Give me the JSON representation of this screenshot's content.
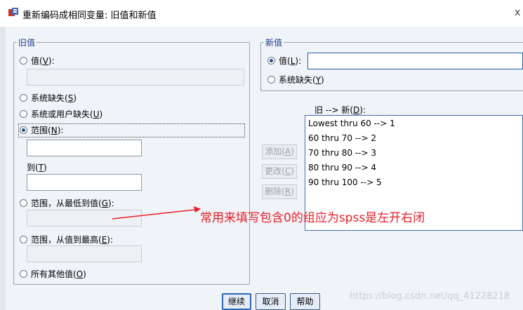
{
  "window": {
    "title": "重新编码成相同变量: 旧值和新值",
    "close": "x"
  },
  "old_value": {
    "legend": "旧值",
    "value_label": "值",
    "value_key": "V",
    "system_missing_label": "系统缺失",
    "system_missing_key": "S",
    "system_or_user_missing_label": "系统或用户缺失",
    "system_or_user_missing_key": "U",
    "range_label": "范围",
    "range_key": "N",
    "to_label": "到",
    "to_key": "T",
    "range_lowest_label": "范围，从最低到值",
    "range_lowest_key": "G",
    "range_highest_label": "范围，从值到最高",
    "range_highest_key": "E",
    "all_other_label": "所有其他值",
    "all_other_key": "O",
    "selected": "range"
  },
  "new_value": {
    "legend": "新值",
    "value_label": "值",
    "value_key": "L",
    "value_input": "",
    "system_missing_label": "系统缺失",
    "system_missing_key": "Y",
    "selected": "value"
  },
  "mapping": {
    "label": "旧 --> 新",
    "label_key": "D",
    "items": [
      "Lowest thru 60 --> 1",
      "60 thru 70 --> 2",
      "70 thru 80 --> 3",
      "80 thru 90 --> 4",
      "90 thru 100 --> 5"
    ]
  },
  "side_buttons": {
    "add": "添加",
    "add_key": "A",
    "change": "更改",
    "change_key": "C",
    "remove": "删除",
    "remove_key": "R"
  },
  "footer": {
    "continue": "继续",
    "cancel": "取消",
    "help": "帮助"
  },
  "annotation": {
    "text": "常用来填写包含0的组应为spss是左开右闭",
    "color": "#e8202a"
  },
  "watermark": "https://blog.csdn.net/qq_41228218"
}
